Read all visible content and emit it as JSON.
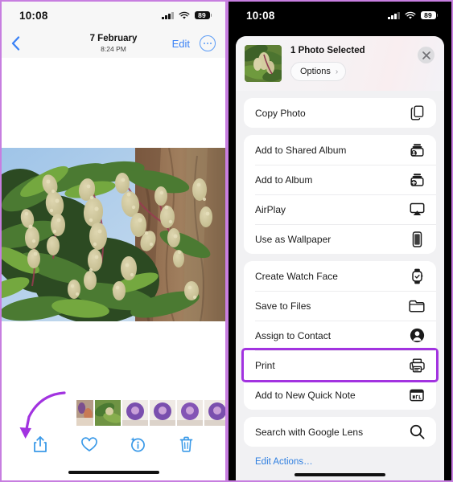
{
  "left_phone": {
    "status_bar": {
      "time": "10:08",
      "battery": "89",
      "signal_icon": "cellular-bars-icon",
      "wifi_icon": "wifi-icon",
      "battery_icon": "battery-icon"
    },
    "nav": {
      "back_icon": "chevron-left-icon",
      "title": "7 February",
      "subtitle": "8:24 PM",
      "edit_label": "Edit",
      "more_icon": "ellipsis-circle-icon"
    },
    "photo": {
      "name": "mango-flower-photo",
      "alt": "Mango tree flowering panicles with green leaves"
    },
    "filmstrip": {
      "name": "photo-filmstrip",
      "thumb_count": 8
    },
    "toolbar": [
      {
        "name": "share-button",
        "icon": "share-upload-icon"
      },
      {
        "name": "favorite-button",
        "icon": "heart-icon"
      },
      {
        "name": "info-button",
        "icon": "info-sparkle-icon"
      },
      {
        "name": "delete-button",
        "icon": "trash-icon"
      }
    ],
    "annotation": {
      "name": "arrow-to-share-button",
      "color": "#a233e0"
    },
    "home_indicator": "home-indicator"
  },
  "right_phone": {
    "status_bar": {
      "time": "10:08",
      "battery": "89",
      "signal_icon": "cellular-bars-icon",
      "wifi_icon": "wifi-icon",
      "battery_icon": "battery-icon"
    },
    "share_sheet": {
      "title": "1 Photo Selected",
      "options_label": "Options",
      "options_chevron": "›",
      "close_icon": "close-icon",
      "thumbnail": "selected-photo-thumbnail",
      "groups": [
        {
          "items": [
            {
              "label": "Copy Photo",
              "icon": "copy-icon"
            }
          ]
        },
        {
          "items": [
            {
              "label": "Add to Shared Album",
              "icon": "shared-album-icon"
            },
            {
              "label": "Add to Album",
              "icon": "add-album-icon"
            },
            {
              "label": "AirPlay",
              "icon": "airplay-icon"
            },
            {
              "label": "Use as Wallpaper",
              "icon": "wallpaper-iphone-icon"
            }
          ]
        },
        {
          "items": [
            {
              "label": "Create Watch Face",
              "icon": "watch-icon"
            },
            {
              "label": "Save to Files",
              "icon": "folder-icon"
            },
            {
              "label": "Assign to Contact",
              "icon": "contact-person-icon"
            },
            {
              "label": "Print",
              "icon": "printer-icon",
              "highlighted": true
            },
            {
              "label": "Add to New Quick Note",
              "icon": "quick-note-icon"
            }
          ]
        },
        {
          "items": [
            {
              "label": "Search with Google Lens",
              "icon": "magnifier-icon"
            }
          ]
        }
      ],
      "edit_actions_label": "Edit Actions…"
    },
    "home_indicator": "home-indicator"
  },
  "colors": {
    "frame_border": "#c77ee0",
    "highlight": "#a233e0",
    "ios_blue": "#3b82f6",
    "link_blue": "#2f7fe0",
    "toolbar_blue": "#3b9ae8",
    "sheet_bg": "#f1f1f3",
    "row_bg": "#ffffff"
  }
}
